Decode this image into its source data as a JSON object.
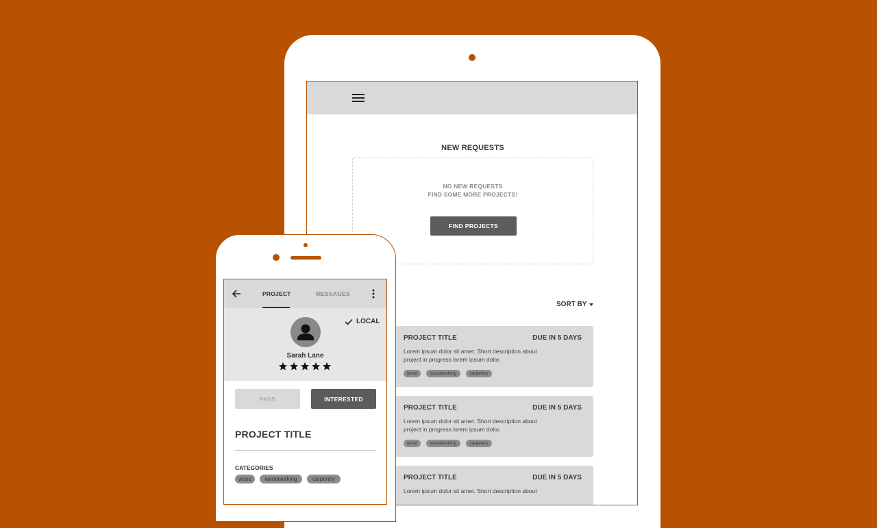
{
  "colors": {
    "background": "#b85200",
    "bar": "#d9d9d9",
    "button_dark": "#5c5c5c"
  },
  "tablet": {
    "menu_icon": "hamburger-icon",
    "section_title": "NEW REQUESTS",
    "empty_state": {
      "line1": "NO NEW REQUESTS",
      "line2": "FIND SOME MORE PROJECTS!",
      "button_label": "FIND PROJECTS"
    },
    "sort_label": "SORT BY",
    "cards": [
      {
        "title": "PROJECT TITLE",
        "due": "DUE IN 5 DAYS",
        "desc1": "Lorem ipsum dolor sit amet. Short description about",
        "desc2": "project in progress lorem ipsum dolor.",
        "tags": [
          "wood",
          "woodworking",
          "carpentry"
        ]
      },
      {
        "title": "PROJECT TITLE",
        "due": "DUE IN 5 DAYS",
        "desc1": "Lorem ipsum dolor sit amet. Short description about",
        "desc2": "project in progress lorem ipsum dolor.",
        "tags": [
          "wood",
          "woodworking",
          "carpentry"
        ]
      },
      {
        "title": "PROJECT TITLE",
        "due": "DUE IN 5 DAYS",
        "desc1": "Lorem ipsum dolor sit amet. Short description about",
        "desc2": "",
        "tags": []
      }
    ]
  },
  "phone": {
    "tabs": [
      {
        "label": "PROJECT",
        "active": true
      },
      {
        "label": "MESSAGES",
        "active": false
      }
    ],
    "profile": {
      "name": "Sarah Lane",
      "rating": 5,
      "badge": "LOCAL"
    },
    "pass_label": "PASS",
    "interested_label": "INTERESTED",
    "project_title": "PROJECT TITLE",
    "categories_label": "CATEGORIES",
    "categories": [
      "wood",
      "woodworking",
      "carpentry"
    ]
  }
}
